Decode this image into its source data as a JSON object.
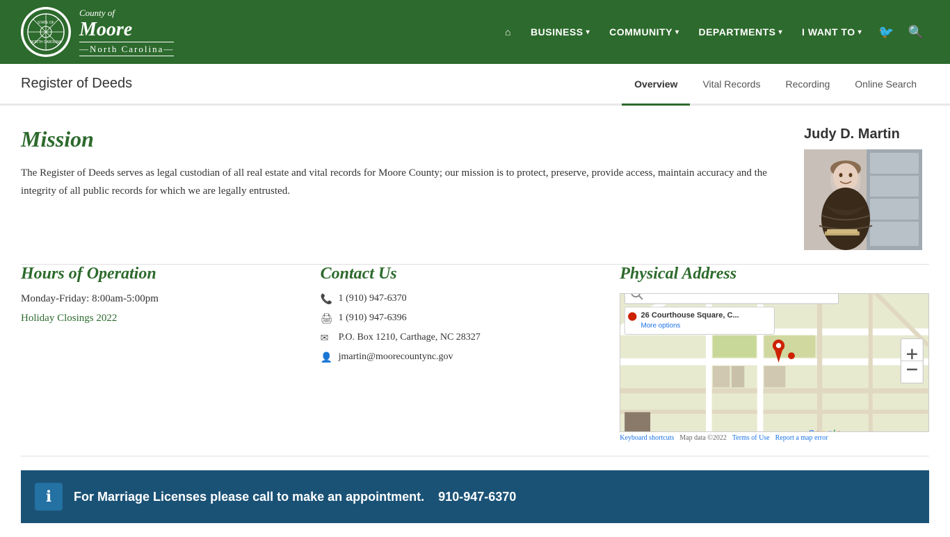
{
  "header": {
    "logo_county_of": "County of",
    "logo_name": "Moore",
    "logo_state": "—North Carolina—",
    "nav_items": [
      {
        "label": "BUSINESS",
        "has_caret": true
      },
      {
        "label": "COMMUNITY",
        "has_caret": true
      },
      {
        "label": "DEPARTMENTS",
        "has_caret": true
      },
      {
        "label": "I WANT TO",
        "has_caret": true
      }
    ]
  },
  "subheader": {
    "page_title": "Register of Deeds",
    "tabs": [
      {
        "label": "Overview",
        "active": true
      },
      {
        "label": "Vital Records",
        "active": false
      },
      {
        "label": "Recording",
        "active": false
      },
      {
        "label": "Online Search",
        "active": false
      }
    ]
  },
  "main": {
    "mission": {
      "title": "Mission",
      "body": "The Register of Deeds serves as legal custodian of all real estate and vital records for Moore County; our mission is to protect, preserve, provide access, maintain accuracy and the integrity of all public records for which we are legally entrusted."
    },
    "official": {
      "name": "Judy D. Martin"
    }
  },
  "hours": {
    "title": "Hours of Operation",
    "schedule": "Monday-Friday:  8:00am-5:00pm",
    "holiday_link": "Holiday Closings 2022"
  },
  "contact": {
    "title": "Contact Us",
    "phone": "1 (910) 947-6370",
    "fax": "1 (910) 947-6396",
    "po_box": "P.O. Box 1210, Carthage, NC 28327",
    "email": "jmartin@moorecountync.gov"
  },
  "physical": {
    "title": "Physical Address",
    "address": "26 Courthouse Square, C...",
    "more_options": "More options",
    "map_footer": {
      "keyboard": "Keyboard shortcuts",
      "data": "Map data ©2022",
      "terms": "Terms of Use",
      "report": "Report a map error"
    }
  },
  "banner": {
    "text": "For Marriage Licenses please call to make an appointment.",
    "phone": "910-947-6370"
  }
}
